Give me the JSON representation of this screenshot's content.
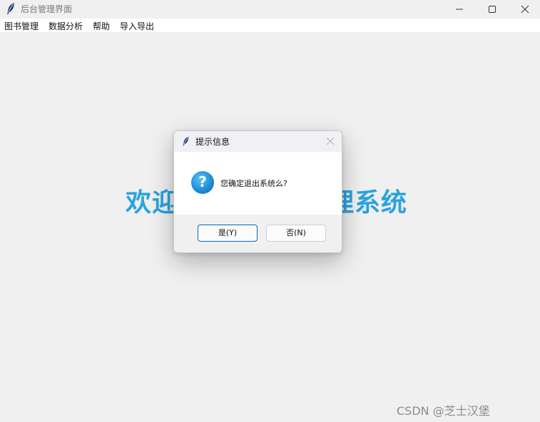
{
  "window": {
    "title": "后台管理界面",
    "icon": "feather-icon"
  },
  "menubar": {
    "items": [
      {
        "label": "图书管理"
      },
      {
        "label": "数据分析"
      },
      {
        "label": "帮助"
      },
      {
        "label": "导入导出"
      }
    ]
  },
  "main": {
    "banner_left": "欢迎",
    "banner_right": "理系统",
    "banner_color": "#29a3e0"
  },
  "dialog": {
    "title": "提示信息",
    "icon": "question-icon",
    "message": "您确定退出系统么?",
    "yes_label": "是(Y)",
    "no_label": "否(N)"
  },
  "watermark": "CSDN @芝士汉堡 ￼￼￼￼"
}
